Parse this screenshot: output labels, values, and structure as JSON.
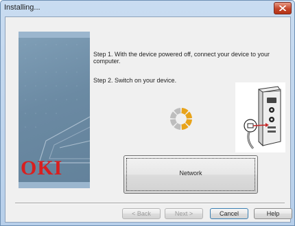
{
  "window": {
    "title": "Installing...",
    "close_icon": "close-x-icon",
    "close_color": "#c7432a"
  },
  "brand": {
    "logo_text": "OKI",
    "logo_color": "#d81f1f"
  },
  "steps": {
    "step1": "Step 1. With the device powered off, connect your device to your computer.",
    "step2": "Step 2. Switch on your device."
  },
  "progress": {
    "icon": "busy-spinner-icon",
    "colors": [
      "#e8a31a",
      "#bdbdbd"
    ]
  },
  "illustration": {
    "icon": "usb-cable-to-computer-icon"
  },
  "network_button": {
    "label": "Network"
  },
  "footer": {
    "back_label": "< Back",
    "next_label": "Next >",
    "cancel_label": "Cancel",
    "help_label": "Help"
  }
}
